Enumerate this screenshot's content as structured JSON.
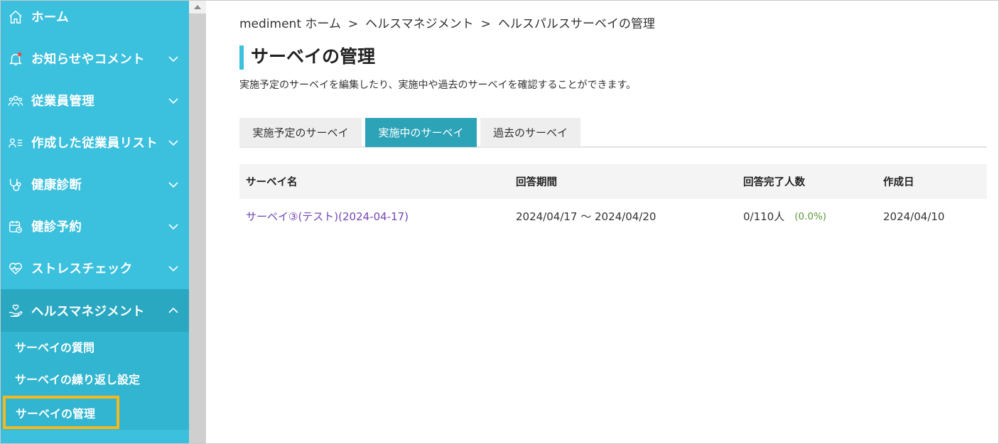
{
  "sidebar": {
    "items": [
      {
        "label": "ホーム",
        "icon": "home-icon",
        "has_chevron": false
      },
      {
        "label": "お知らせやコメント",
        "icon": "bell-icon",
        "has_chevron": true
      },
      {
        "label": "従業員管理",
        "icon": "users-icon",
        "has_chevron": true
      },
      {
        "label": "作成した従業員リスト",
        "icon": "user-list-icon",
        "has_chevron": true
      },
      {
        "label": "健康診断",
        "icon": "stethoscope-icon",
        "has_chevron": true
      },
      {
        "label": "健診予約",
        "icon": "calendar-icon",
        "has_chevron": true
      },
      {
        "label": "ストレスチェック",
        "icon": "heart-icon",
        "has_chevron": true
      },
      {
        "label": "ヘルスマネジメント",
        "icon": "hand-heart-icon",
        "has_chevron": true,
        "expanded": true
      }
    ],
    "submenu": [
      {
        "label": "サーベイの質問"
      },
      {
        "label": "サーベイの繰り返し設定"
      },
      {
        "label": "サーベイの管理",
        "current": true
      }
    ],
    "bg_color": "#3bc0dd",
    "active_color": "#2aa8c2",
    "highlight_color": "#f6b81c"
  },
  "breadcrumb": {
    "items": [
      "mediment ホーム",
      "ヘルスマネジメント",
      "ヘルスパルスサーベイの管理"
    ],
    "separator": ">"
  },
  "page": {
    "title": "サーベイの管理",
    "description": "実施予定のサーベイを編集したり、実施中や過去のサーベイを確認することができます。"
  },
  "tabs": [
    {
      "label": "実施予定のサーベイ",
      "active": false
    },
    {
      "label": "実施中のサーベイ",
      "active": true
    },
    {
      "label": "過去のサーベイ",
      "active": false
    }
  ],
  "table": {
    "headers": [
      "サーベイ名",
      "回答期間",
      "回答完了人数",
      "作成日"
    ],
    "rows": [
      {
        "name": "サーベイ③(テスト)(2024-04-17)",
        "period": "2024/04/17 ～ 2024/04/20",
        "completed": "0/110人",
        "percent": "(0.0%)",
        "created": "2024/04/10"
      }
    ]
  },
  "colors": {
    "accent": "#3bc0dd",
    "tab_active": "#2ca3b7",
    "link": "#7246b5",
    "percent": "#5a9a3a"
  }
}
